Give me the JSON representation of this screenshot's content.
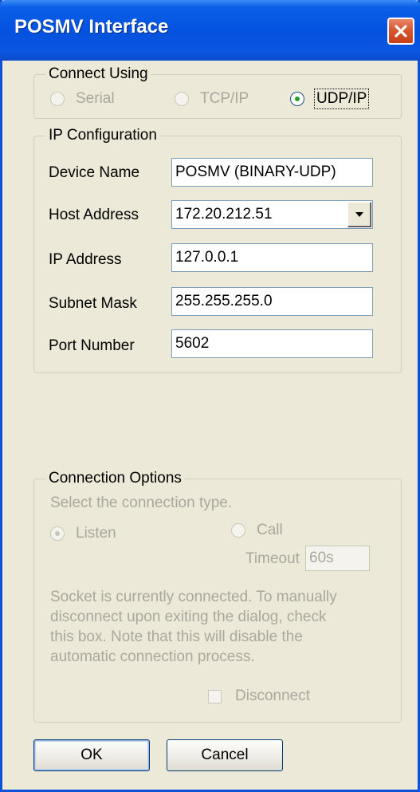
{
  "window": {
    "title": "POSMV Interface"
  },
  "connect_using": {
    "legend": "Connect Using",
    "options": [
      {
        "label": "Serial",
        "selected": false,
        "enabled": false
      },
      {
        "label": "TCP/IP",
        "selected": false,
        "enabled": false
      },
      {
        "label": "UDP/IP",
        "selected": true,
        "enabled": true
      }
    ]
  },
  "ip_config": {
    "legend": "IP Configuration",
    "device_name": {
      "label": "Device Name",
      "value": "POSMV (BINARY-UDP)"
    },
    "host_address": {
      "label": "Host Address",
      "value": "172.20.212.51"
    },
    "ip_address": {
      "label": "IP Address",
      "value": "127.0.0.1"
    },
    "subnet_mask": {
      "label": "Subnet Mask",
      "value": "255.255.255.0"
    },
    "port_number": {
      "label": "Port Number",
      "value": "5602"
    }
  },
  "connection_options": {
    "legend": "Connection Options",
    "hint": "Select the connection type.",
    "listen_label": "Listen",
    "call_label": "Call",
    "timeout_label": "Timeout",
    "timeout_value": "60s",
    "note_lines": [
      "Socket is currently connected. To manually",
      "disconnect upon exiting the dialog, check",
      "this box. Note that this will disable the",
      "automatic connection process."
    ],
    "disconnect_label": "Disconnect"
  },
  "buttons": {
    "ok": "OK",
    "cancel": "Cancel"
  },
  "colors": {
    "title_bar": "#0552e0",
    "dialog_bg": "#ece9d8",
    "close_button": "#d9562e",
    "radio_selected": "#21a121"
  }
}
